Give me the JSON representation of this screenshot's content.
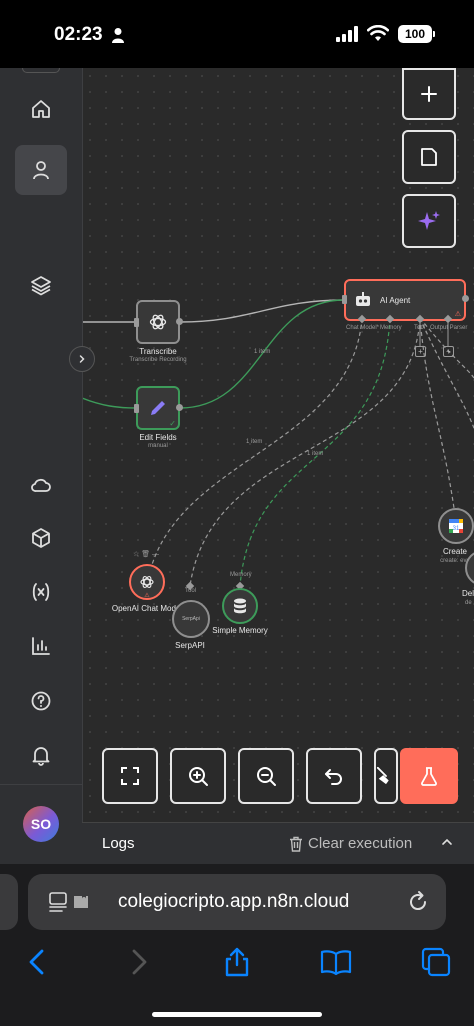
{
  "status_bar": {
    "time": "02:23",
    "battery": "100"
  },
  "sidebar": {
    "items": [
      {
        "name": "home",
        "active": false
      },
      {
        "name": "personal",
        "active": true
      },
      {
        "name": "projects",
        "active": false
      },
      {
        "name": "cloud",
        "active": false
      },
      {
        "name": "templates",
        "active": false
      },
      {
        "name": "variables",
        "active": false
      },
      {
        "name": "insights",
        "active": false
      },
      {
        "name": "help",
        "active": false
      },
      {
        "name": "notifications",
        "active": false
      }
    ],
    "avatar_initials": "SO"
  },
  "workflow": {
    "nodes": {
      "transcribe": {
        "label": "Transcribe",
        "sub": "Transcribe Recording"
      },
      "edit_fields": {
        "label": "Edit Fields",
        "sub": "manual"
      },
      "ai_agent": {
        "label": "AI Agent",
        "ports": [
          "Chat Model*",
          "Memory",
          "Tool",
          "Output Parser"
        ]
      },
      "openai": {
        "label": "OpenAI Chat Model"
      },
      "serpapi": {
        "label": "SerpAPI",
        "inner": "SerpApi",
        "port": "Tool"
      },
      "memory": {
        "label": "Simple Memory",
        "port": "Memory"
      },
      "create": {
        "label": "Create",
        "sub": "create: eve"
      },
      "delete": {
        "label": "Del",
        "sub": "de"
      }
    },
    "edge_labels": [
      "1 item",
      "1 item",
      "1 item"
    ]
  },
  "toolbar": {
    "buttons": [
      "fit-view",
      "zoom-in",
      "zoom-out",
      "undo",
      "tidy-up",
      "test-workflow"
    ]
  },
  "logs": {
    "title": "Logs",
    "clear": "Clear execution"
  },
  "browser": {
    "url": "colegiocripto.app.n8n.cloud"
  },
  "colors": {
    "accent": "#ff6d5a",
    "agent_border": "#ff6d5a",
    "edit_border": "#3d9b5a",
    "canvas": "#2a2a2a"
  }
}
